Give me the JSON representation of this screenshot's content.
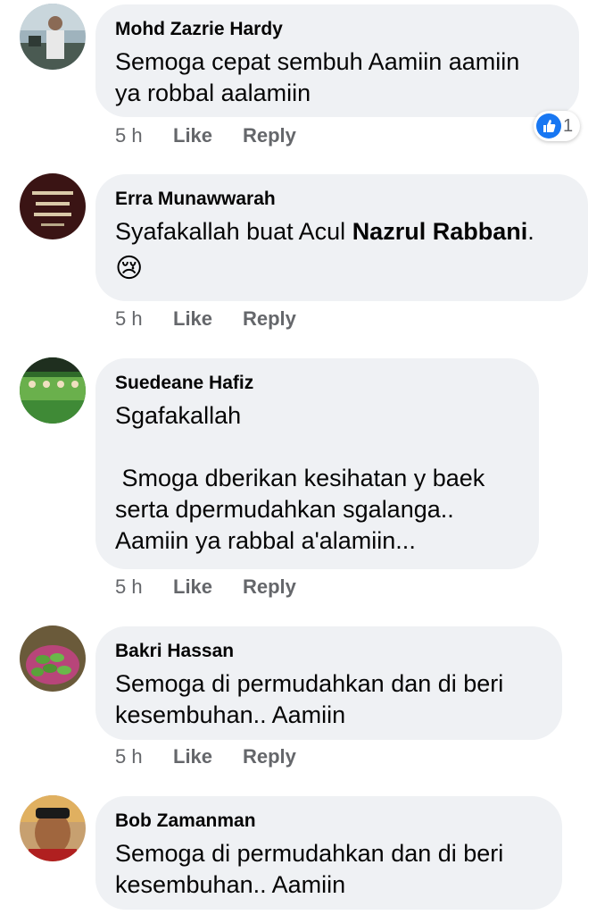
{
  "comments": [
    {
      "author": "Mohd Zazrie Hardy",
      "text": "Semoga cepat sembuh Aamiin aamiin\nya robbal aalamiin",
      "time": "5 h",
      "like_label": "Like",
      "reply_label": "Reply",
      "reaction_count": "1"
    },
    {
      "author": "Erra Munawwarah",
      "text_before": "Syafakallah buat Acul ",
      "mention": "Nazrul Rabbani",
      "text_after": ".",
      "emoji": "😢",
      "time": "5 h",
      "like_label": "Like",
      "reply_label": "Reply"
    },
    {
      "author": "Suedeane Hafiz",
      "text": "Sgafakallah\n\n Smoga dberikan kesihatan y baek\nserta dpermudahkan sgalanga..\nAamiin ya rabbal a'alamiin...",
      "time": "5 h",
      "like_label": "Like",
      "reply_label": "Reply"
    },
    {
      "author": "Bakri Hassan",
      "text": "Semoga di permudahkan dan di beri\nkesembuhan.. Aamiin",
      "time": "5 h",
      "like_label": "Like",
      "reply_label": "Reply"
    },
    {
      "author": "Bob Zamanman",
      "text": "Semoga di permudahkan dan di beri\nkesembuhan.. Aamiin"
    }
  ],
  "icons": {
    "reaction": "like-thumb-icon"
  },
  "colors": {
    "bubble": "#eff1f4",
    "meta_text": "#65676b",
    "like_blue": "#1877f2"
  }
}
